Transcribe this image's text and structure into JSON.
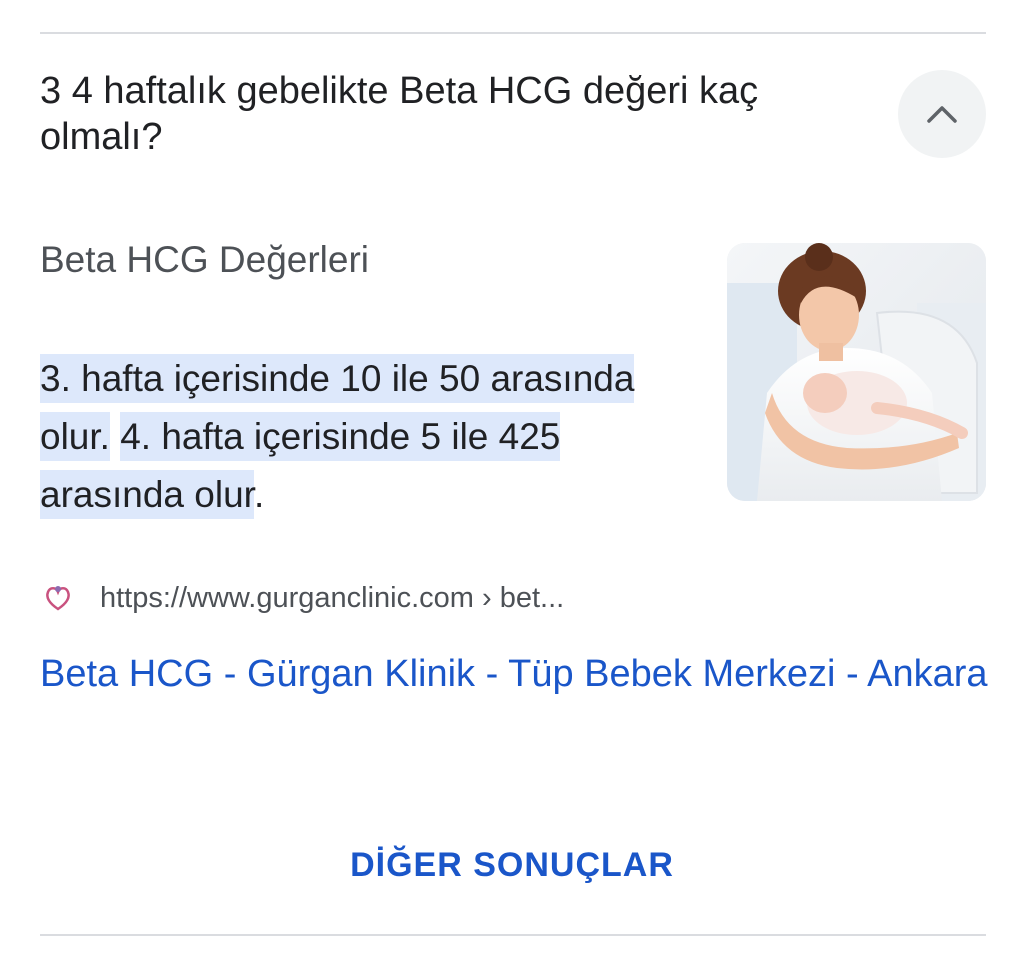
{
  "question": {
    "text": "3 4 haftalık gebelikte Beta HCG değeri kaç olmalı?",
    "collapse_icon": "chevron-up-icon"
  },
  "answer": {
    "heading": "Beta HCG Değerleri",
    "segment1": "3. hafta içerisinde 10 ile 50 arasında olur.",
    "segment2": "4. hafta içerisinde 5 ile 425 arasında olur",
    "trailing": ".",
    "highlight_color": "#dde8fb"
  },
  "source": {
    "favicon": "gurgan-clinic-favicon",
    "url": "https://www.gurganclinic.com › bet...",
    "title": "Beta HCG - Gürgan Klinik - Tüp Bebek Merkezi - Ankara"
  },
  "more_results": {
    "label": "DİĞER SONUÇLAR"
  },
  "colors": {
    "link": "#1a56c9",
    "text": "#202124",
    "secondary_text": "#4d5156"
  }
}
